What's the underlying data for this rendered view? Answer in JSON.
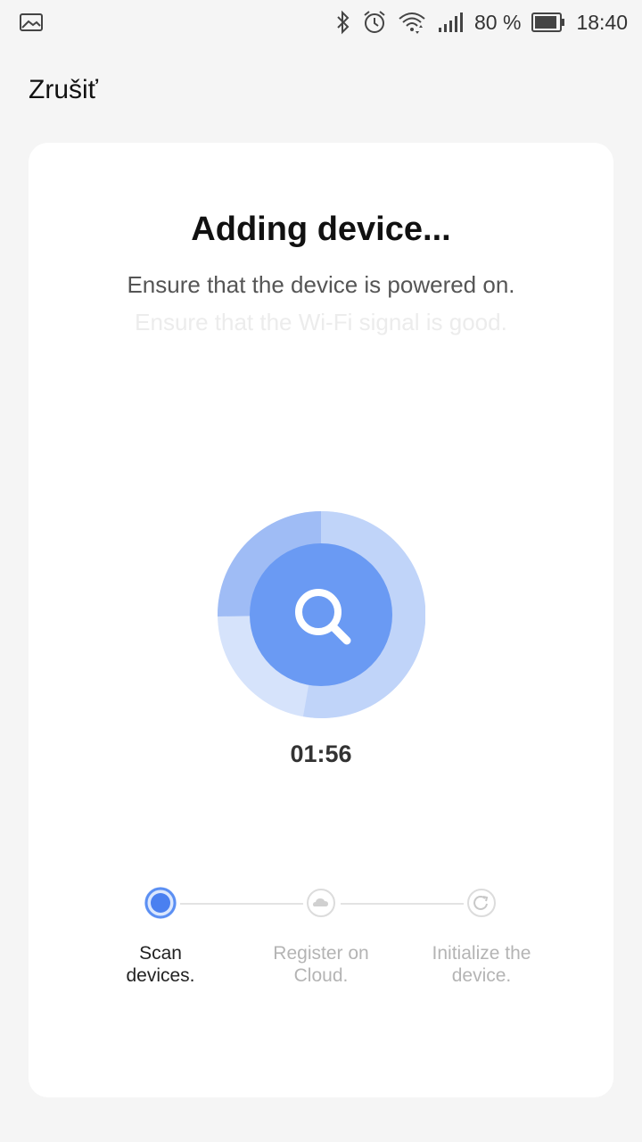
{
  "status_bar": {
    "battery_percent": "80 %",
    "time": "18:40",
    "icons": [
      "image-icon",
      "bluetooth-icon",
      "alarm-icon",
      "wifi-icon",
      "signal-icon",
      "battery-icon"
    ]
  },
  "header": {
    "cancel_label": "Zrušiť"
  },
  "main": {
    "title": "Adding device...",
    "hint_primary": "Ensure that the device is powered on.",
    "hint_secondary": "Ensure that the Wi-Fi signal is good.",
    "timer": "01:56"
  },
  "steps": [
    {
      "label_line1": "Scan",
      "label_line2": "devices.",
      "state": "active",
      "icon": "scan-progress-icon"
    },
    {
      "label_line1": "Register on",
      "label_line2": "Cloud.",
      "state": "pending",
      "icon": "cloud-icon"
    },
    {
      "label_line1": "Initialize the",
      "label_line2": "device.",
      "state": "pending",
      "icon": "refresh-icon"
    }
  ],
  "colors": {
    "accent": "#5b8ff3",
    "accent_light": "#a9c4f8",
    "accent_pale": "#d6e3fb",
    "pending_text": "#b4b4b4",
    "card_bg": "#ffffff",
    "page_bg": "#f5f5f5"
  }
}
